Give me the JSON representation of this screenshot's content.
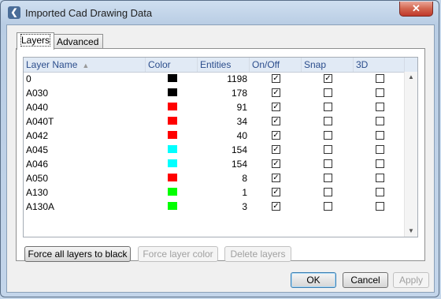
{
  "window": {
    "title": "Imported Cad Drawing Data",
    "close_label": "✕"
  },
  "tabs": [
    {
      "label": "Layers",
      "active": true
    },
    {
      "label": "Advanced",
      "active": false
    }
  ],
  "grid": {
    "columns": [
      "Layer Name",
      "Color",
      "Entities",
      "On/Off",
      "Snap",
      "3D"
    ],
    "sort_indicator": "▲",
    "rows": [
      {
        "name": "0",
        "color": "#000000",
        "entities": "1198",
        "on": true,
        "snap": true,
        "three_d": false
      },
      {
        "name": "A030",
        "color": "#000000",
        "entities": "178",
        "on": true,
        "snap": false,
        "three_d": false
      },
      {
        "name": "A040",
        "color": "#ff0000",
        "entities": "91",
        "on": true,
        "snap": false,
        "three_d": false
      },
      {
        "name": "A040T",
        "color": "#ff0000",
        "entities": "34",
        "on": true,
        "snap": false,
        "three_d": false
      },
      {
        "name": "A042",
        "color": "#ff0000",
        "entities": "40",
        "on": true,
        "snap": false,
        "three_d": false
      },
      {
        "name": "A045",
        "color": "#00ffff",
        "entities": "154",
        "on": true,
        "snap": false,
        "three_d": false
      },
      {
        "name": "A046",
        "color": "#00ffff",
        "entities": "154",
        "on": true,
        "snap": false,
        "three_d": false
      },
      {
        "name": "A050",
        "color": "#ff0000",
        "entities": "8",
        "on": true,
        "snap": false,
        "three_d": false
      },
      {
        "name": "A130",
        "color": "#00ff00",
        "entities": "1",
        "on": true,
        "snap": false,
        "three_d": false
      },
      {
        "name": "A130A",
        "color": "#00ff00",
        "entities": "3",
        "on": true,
        "snap": false,
        "three_d": false
      }
    ]
  },
  "layer_actions": {
    "force_black": "Force all layers to black",
    "force_color": "Force layer color",
    "delete": "Delete layers"
  },
  "dialog_buttons": {
    "ok": "OK",
    "cancel": "Cancel",
    "apply": "Apply"
  },
  "check_glyph": "✓"
}
